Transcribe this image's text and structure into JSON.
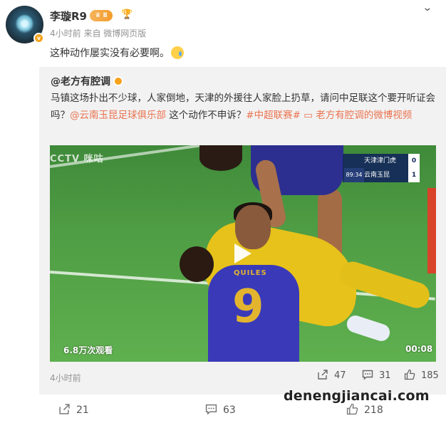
{
  "post": {
    "author": "李璇R9",
    "badge": "Ⅱ",
    "meta": "4小时前 来自 微博网页版",
    "text": "这种动作屡实没有必要啊。"
  },
  "repost": {
    "author": "@老方有腔调",
    "text_main": "马镇这场扑出不少球，人家倒地，天津的外援往人家脸上扔草，请问中足联这个要开听证会吗？",
    "mention_club": "@云南玉昆足球俱乐部",
    "text_mid": " 这个动作不申诉？",
    "hashtag": "#中超联赛#",
    "video_link": "老方有腔调的微博视频",
    "video": {
      "views": "6.8万次观看",
      "duration": "00:08",
      "broadcaster": "CCTV 咪咕",
      "scoreboard": {
        "team1": "天津津门虎",
        "score1": "0",
        "team2": "云南玉昆",
        "score2": "1",
        "clock": "89:34"
      },
      "jersey_name": "QUILES",
      "jersey_number": "9"
    },
    "time": "4小时前",
    "forwards": "47",
    "comments": "31",
    "likes": "185"
  },
  "actions": {
    "forwards": "21",
    "comments": "63",
    "likes": "218"
  },
  "watermark": "denengjiancai.com",
  "colors": {
    "link": "#eb7350",
    "badge": "#f7a21b",
    "meta": "#939393"
  }
}
